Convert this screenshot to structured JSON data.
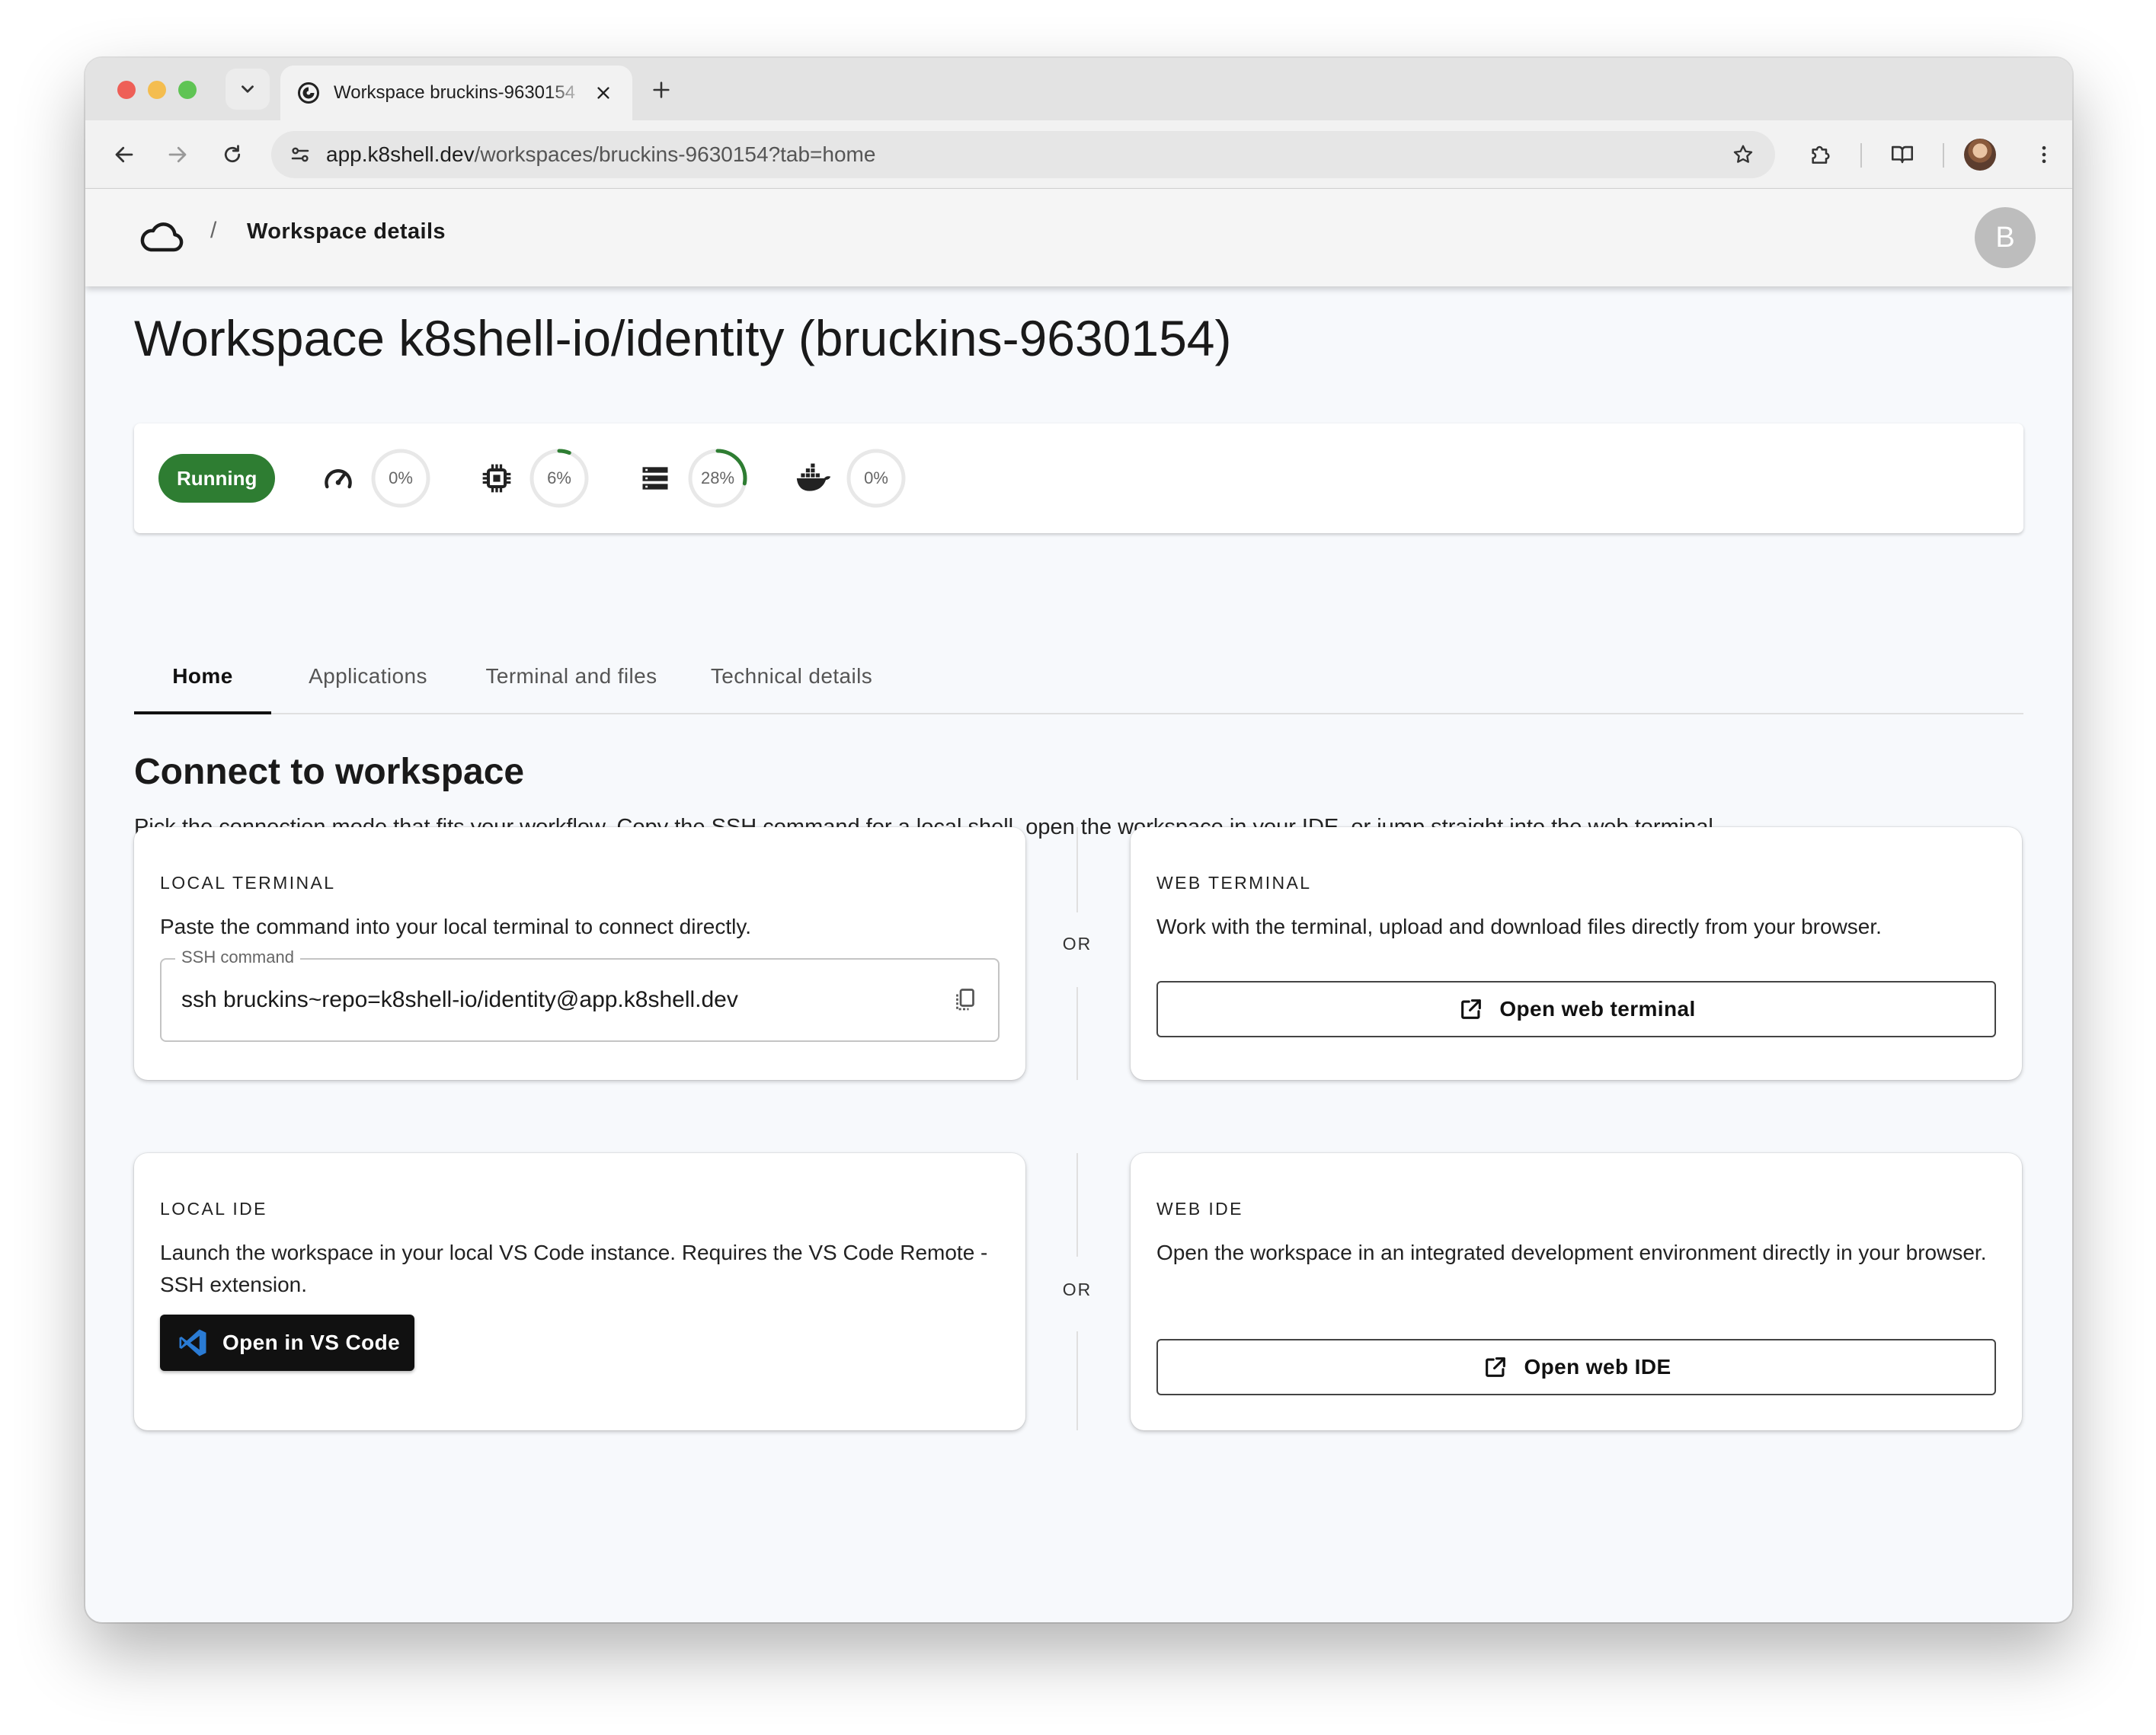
{
  "browser": {
    "tab_title": "Workspace bruckins-9630154",
    "url_host": "app.k8shell.dev",
    "url_path": "/workspaces/bruckins-9630154?tab=home"
  },
  "appbar": {
    "breadcrumb_separator": "/",
    "breadcrumb": "Workspace details",
    "avatar_initial": "B"
  },
  "page": {
    "title": "Workspace k8shell-io/identity (bruckins-9630154)"
  },
  "status": {
    "state_label": "Running",
    "state_color": "#2e7d32",
    "metrics": [
      {
        "icon": "speedometer-icon",
        "value": 0,
        "label": "0%"
      },
      {
        "icon": "cpu-chip-icon",
        "value": 6,
        "label": "6%"
      },
      {
        "icon": "storage-icon",
        "value": 28,
        "label": "28%"
      },
      {
        "icon": "docker-icon",
        "value": 0,
        "label": "0%"
      }
    ],
    "ring_color": "#2e7d32"
  },
  "tabs": [
    {
      "label": "Home",
      "active": true
    },
    {
      "label": "Applications",
      "active": false
    },
    {
      "label": "Terminal and files",
      "active": false
    },
    {
      "label": "Technical details",
      "active": false
    }
  ],
  "connect": {
    "title": "Connect to workspace",
    "description": "Pick the connection mode that fits your workflow. Copy the SSH command for a local shell, open the workspace in your IDE, or jump straight into the web terminal.",
    "or_label": "OR",
    "local_terminal": {
      "overline": "LOCAL TERMINAL",
      "description": "Paste the command into your local terminal to connect directly.",
      "field_label": "SSH command",
      "field_value": "ssh bruckins~repo=k8shell-io/identity@app.k8shell.dev"
    },
    "web_terminal": {
      "overline": "WEB TERMINAL",
      "description": "Work with the terminal, upload and download files directly from your browser.",
      "button_label": "Open web terminal"
    },
    "local_ide": {
      "overline": "LOCAL IDE",
      "description": "Launch the workspace in your local VS Code instance. Requires the VS Code Remote - SSH extension.",
      "button_label": "Open in VS Code"
    },
    "web_ide": {
      "overline": "WEB IDE",
      "description": "Open the workspace in an integrated development environment directly in your browser.",
      "button_label": "Open web IDE"
    }
  }
}
